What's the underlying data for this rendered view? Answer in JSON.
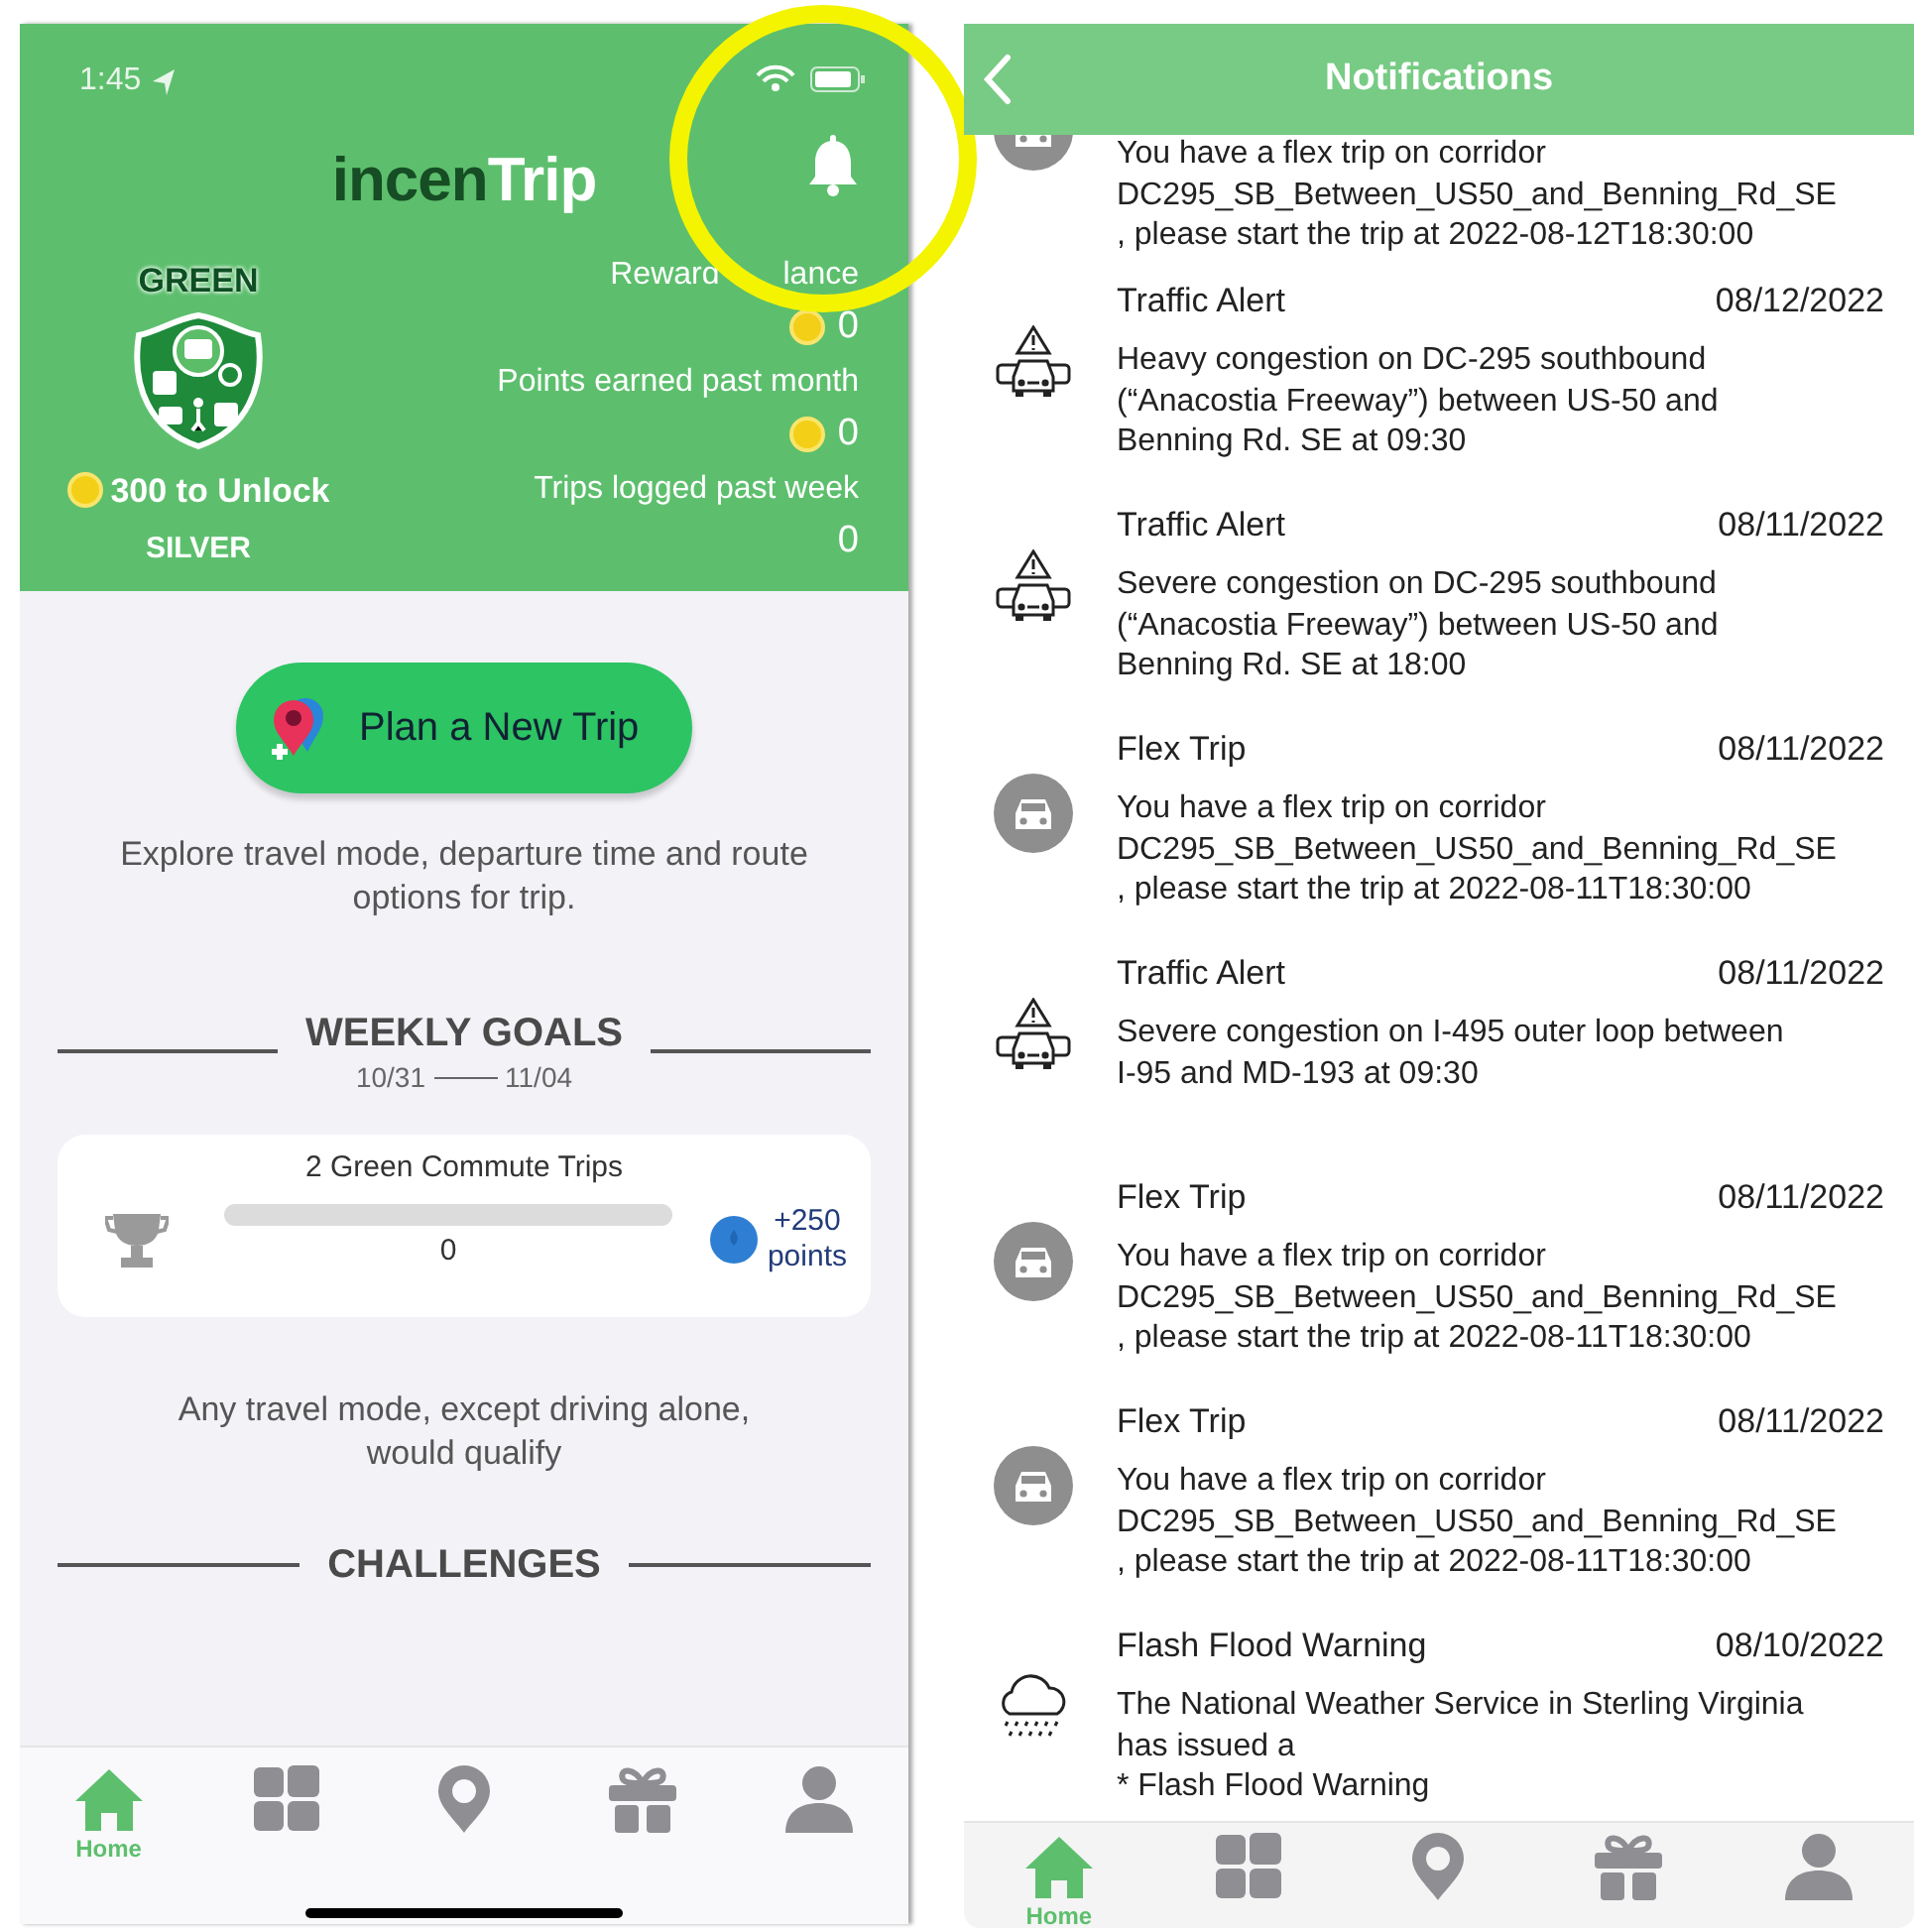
{
  "home_screen": {
    "status_bar": {
      "time": "1:45"
    },
    "logo": {
      "part_1": "incen",
      "part_2": "Trip"
    },
    "tier": {
      "current": "GREEN",
      "unlock_text": "300 to Unlock",
      "next": "SILVER"
    },
    "stats": [
      {
        "label_parts": [
          "Reward",
          "lance"
        ],
        "value": "0",
        "kind": "coin"
      },
      {
        "label_parts": [
          "Points earned past month"
        ],
        "value": "0",
        "kind": "coin"
      },
      {
        "label_parts": [
          "Trips logged past week"
        ],
        "value": "0",
        "kind": "plain"
      }
    ],
    "plan_button": {
      "label": "Plan a New Trip"
    },
    "plan_description": "Explore travel mode, departure time and route options for trip.",
    "weekly_goals": {
      "title": "WEEKLY GOALS",
      "start": "10/31",
      "end": "11/04"
    },
    "goal": {
      "title": "2 Green Commute Trips",
      "level": 0,
      "progress": "0",
      "reward": "+250",
      "reward_unit": "points"
    },
    "qualify_note": "Any travel mode, except driving alone, would qualify",
    "challenges": {
      "title": "CHALLENGES"
    },
    "tab_bar": [
      {
        "kind": "home",
        "label": "Home",
        "selected": true
      },
      {
        "kind": "grid",
        "selected": false
      },
      {
        "kind": "pin",
        "selected": false
      },
      {
        "kind": "gift",
        "selected": false
      },
      {
        "kind": "person",
        "selected": false
      }
    ]
  },
  "notifications_screen": {
    "title": "Notifications",
    "items": [
      {
        "kind": "flex",
        "partial": true,
        "body": [
          "You have a flex trip on corridor",
          "DC295_SB_Between_US50_and_Benning_Rd_SE",
          ", please start the trip at 2022-08-12T18:30:00"
        ]
      },
      {
        "kind": "traffic",
        "title": "Traffic Alert",
        "date": "08/12/2022",
        "body": [
          "Heavy congestion on DC-295 southbound",
          "(“Anacostia Freeway”) between US-50 and",
          "Benning Rd. SE at 09:30"
        ]
      },
      {
        "kind": "traffic",
        "title": "Traffic Alert",
        "date": "08/11/2022",
        "body": [
          "Severe congestion on DC-295 southbound",
          "(“Anacostia Freeway”) between US-50 and",
          "Benning Rd. SE at 18:00"
        ]
      },
      {
        "kind": "flex",
        "title": "Flex Trip",
        "date": "08/11/2022",
        "body": [
          "You have a flex trip on corridor",
          "DC295_SB_Between_US50_and_Benning_Rd_SE",
          ", please start the trip at 2022-08-11T18:30:00"
        ]
      },
      {
        "kind": "traffic",
        "title": "Traffic Alert",
        "date": "08/11/2022",
        "body": [
          "Severe congestion on I-495 outer loop between",
          "I-95 and MD-193 at 09:30"
        ]
      },
      {
        "kind": "flex",
        "title": "Flex Trip",
        "date": "08/11/2022",
        "body": [
          "You have a flex trip on corridor",
          "DC295_SB_Between_US50_and_Benning_Rd_SE",
          ", please start the trip at 2022-08-11T18:30:00"
        ]
      },
      {
        "kind": "flex",
        "title": "Flex Trip",
        "date": "08/11/2022",
        "body": [
          "You have a flex trip on corridor",
          "DC295_SB_Between_US50_and_Benning_Rd_SE",
          ", please start the trip at 2022-08-11T18:30:00"
        ]
      },
      {
        "kind": "weather",
        "title": "Flash Flood Warning",
        "date": "08/10/2022",
        "body": [
          "The National Weather Service in Sterling Virginia",
          "has issued a",
          "* Flash Flood Warning"
        ]
      }
    ],
    "tab_bar": [
      {
        "kind": "home",
        "label": "Home",
        "selected": true
      },
      {
        "kind": "grid",
        "selected": false
      },
      {
        "kind": "pin",
        "selected": false
      },
      {
        "kind": "gift",
        "selected": false
      },
      {
        "kind": "person",
        "selected": false
      }
    ]
  }
}
